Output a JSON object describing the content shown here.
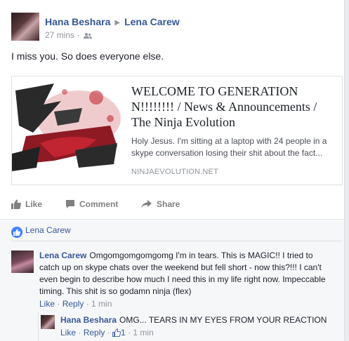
{
  "post": {
    "author": "Hana Besharа",
    "target": "Lena Carew",
    "time": "27 mins",
    "privacy_icon": "friends-icon",
    "text": "I miss you. So does everyone else."
  },
  "link": {
    "title": "WELCOME TO GENERATION N!!!!!!!! / News & Announcements / The Ninja Evolution",
    "description": "Holy Jesus. I'm sitting at a laptop with 24 people in a skype conversation losing their shit about the fact...",
    "domain": "NINJAEVOLUTION.NET"
  },
  "actions": {
    "like": "Like",
    "comment": "Comment",
    "share": "Share"
  },
  "likes": {
    "names": "Lena Carew"
  },
  "comments": [
    {
      "author": "Lena Carew",
      "text": "Omgomgomgomgomg I'm in tears. This is MAGIC!! I tried to catch up on skype chats over the weekend but fell short - now this?!!! I can't even begin to describe how much I need this in my life right now. Impeccable timing. This shit is so godamn ninja (flex)",
      "like": "Like",
      "reply": "Reply",
      "time": "1 min"
    }
  ],
  "reply": {
    "author": "Hana Besharа",
    "text": "OMG... TEARS IN MY EYES FROM YOUR REACTION",
    "like": "Like",
    "reply": "Reply",
    "like_count": "1",
    "time": "1 min"
  },
  "colors": {
    "link_blue": "#365899",
    "meta_gray": "#90949c",
    "like_blue": "#4080ff"
  }
}
